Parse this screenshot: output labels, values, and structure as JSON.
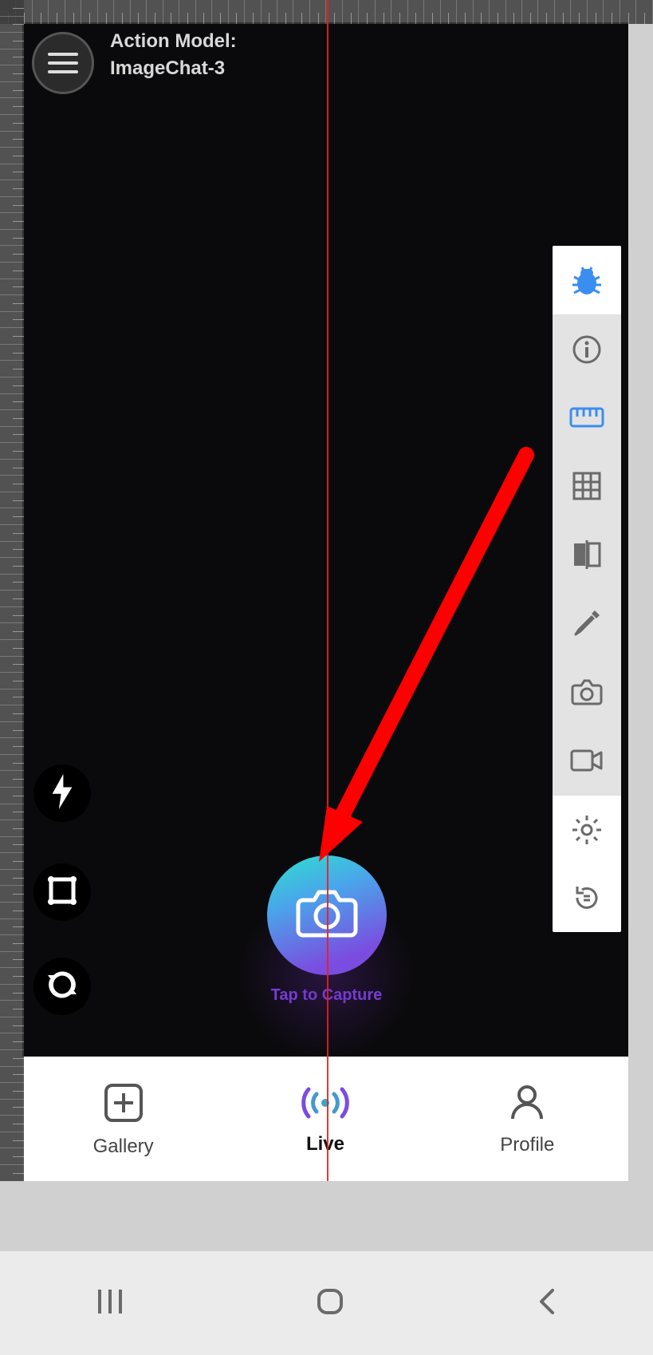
{
  "header": {
    "model_label": "Action Model:",
    "model_name": "ImageChat-3"
  },
  "capture": {
    "label": "Tap to Capture"
  },
  "left_controls": {
    "flash": "flash",
    "frame": "frame",
    "sync": "sync"
  },
  "debug_toolbar": {
    "items": [
      {
        "name": "bug-icon"
      },
      {
        "name": "info-icon"
      },
      {
        "name": "ruler-icon",
        "active": true
      },
      {
        "name": "grid-icon"
      },
      {
        "name": "compare-icon"
      },
      {
        "name": "eyedropper-icon"
      },
      {
        "name": "camera-icon"
      },
      {
        "name": "video-icon"
      },
      {
        "name": "settings-icon"
      },
      {
        "name": "restart-icon"
      }
    ]
  },
  "bottom_nav": {
    "gallery": "Gallery",
    "live": "Live",
    "profile": "Profile",
    "active": "live"
  },
  "system_nav": {
    "recent": "recent-apps",
    "home": "home",
    "back": "back"
  },
  "annotation": {
    "arrow": "points to capture button"
  }
}
